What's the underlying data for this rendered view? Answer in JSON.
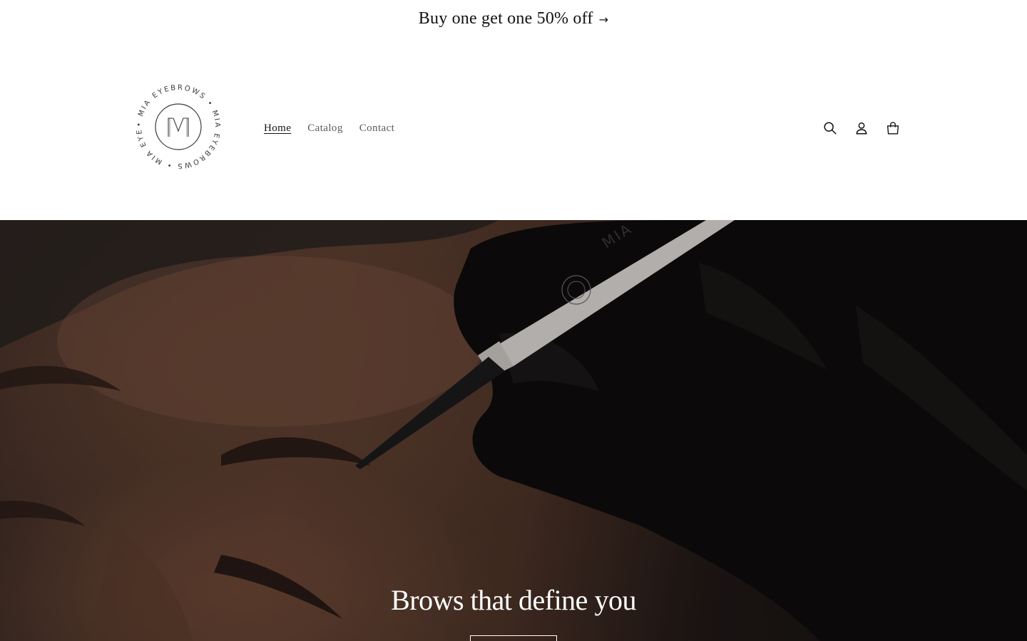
{
  "announcement": {
    "text": "Buy one get one 50% off",
    "arrow_icon": "arrow-right-icon"
  },
  "header": {
    "logo": {
      "brand": "MIA EYEBROWS",
      "monogram": "M"
    },
    "nav": [
      {
        "label": "Home",
        "active": true
      },
      {
        "label": "Catalog",
        "active": false
      },
      {
        "label": "Contact",
        "active": false
      }
    ],
    "icons": [
      "search-icon",
      "account-icon",
      "cart-icon"
    ]
  },
  "hero": {
    "heading": "Brows that define you",
    "button_label": ""
  },
  "colors": {
    "text": "#121212",
    "nav_inactive": "#5a5a5a",
    "hero_text": "#ffffff"
  }
}
